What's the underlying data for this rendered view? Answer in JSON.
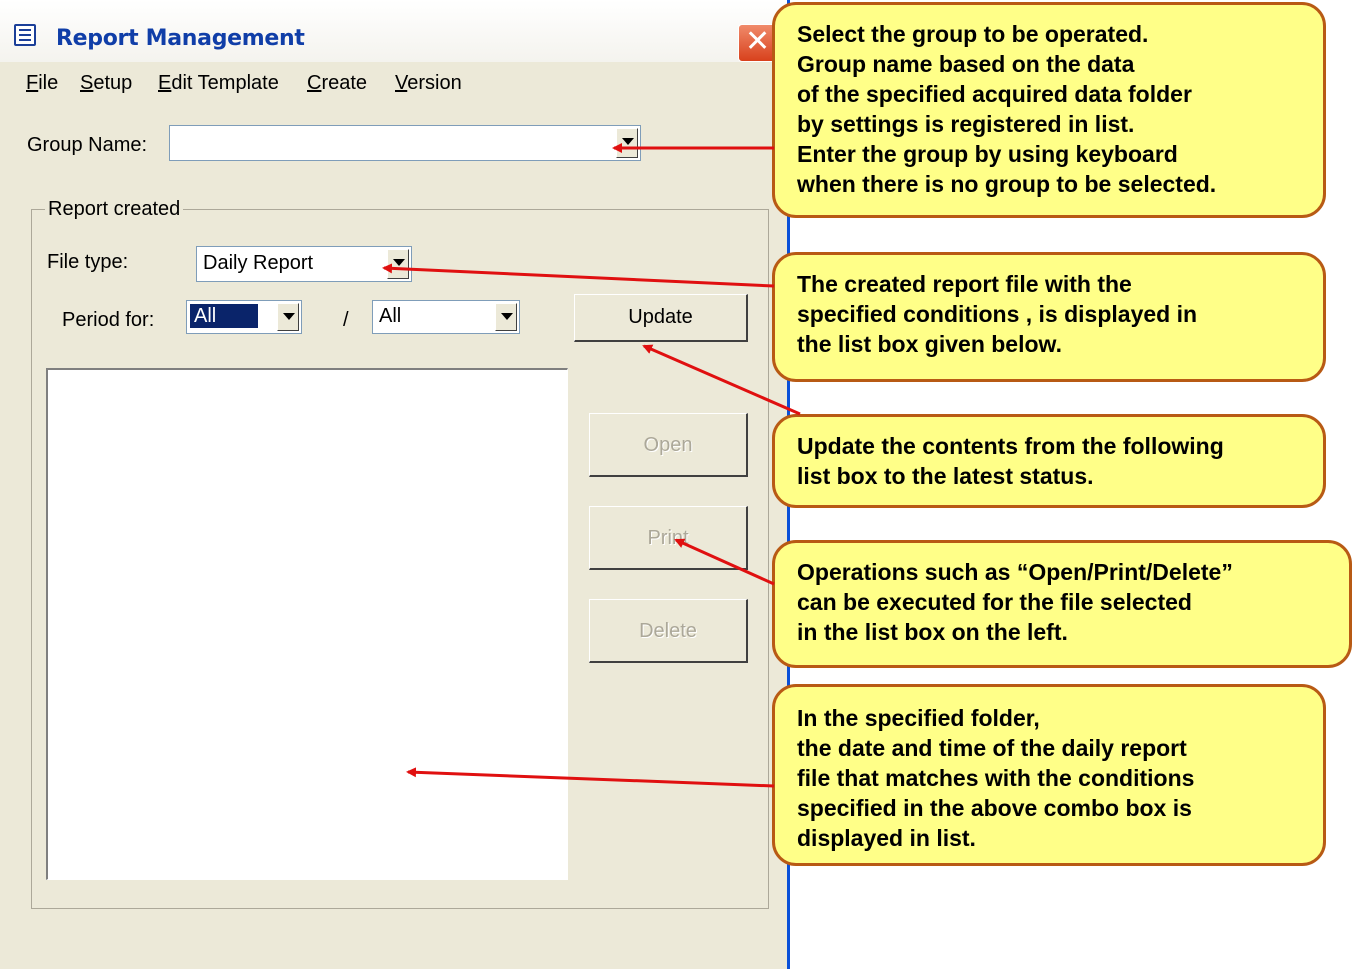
{
  "window": {
    "title": "Report Management",
    "close_glyph": "✕"
  },
  "menu": {
    "items": [
      {
        "label": "File"
      },
      {
        "label": "Setup"
      },
      {
        "label": "Edit Template"
      },
      {
        "label": "Create"
      },
      {
        "label": "Version"
      }
    ]
  },
  "form": {
    "group_name_label": "Group Name:",
    "group_name_value": "",
    "groupbox_title": "Report created",
    "file_type_label": "File type:",
    "file_type_value": "Daily Report",
    "period_label": "Period for:",
    "period_from_value": "All",
    "period_separator": "/",
    "period_to_value": "All"
  },
  "buttons": {
    "update": "Update",
    "open": "Open",
    "print": "Print",
    "delete": "Delete"
  },
  "callouts": {
    "group": "Select the group to be operated.\nGroup name based on the data\nof the specified acquired data folder\nby settings is registered in list.\nEnter the group by using keyboard\nwhen there is no group to be selected.",
    "filetype": "The created report file with the\nspecified conditions , is displayed in\nthe list box given below.",
    "update": "Update the contents from the following\nlist box to the latest status.",
    "operations": "Operations such as “Open/Print/Delete”\ncan be executed for the file selected\nin the list box on the left.",
    "list": "In the specified folder,\nthe date and time of the daily report\nfile that matches with the conditions\nspecified in the above combo box is\ndisplayed in list."
  },
  "colors": {
    "callout_fill": "#ffff88",
    "callout_border": "#b85a14",
    "arrow": "#e01010",
    "title_text": "#103ea8",
    "window_bg": "#ece9d8"
  }
}
